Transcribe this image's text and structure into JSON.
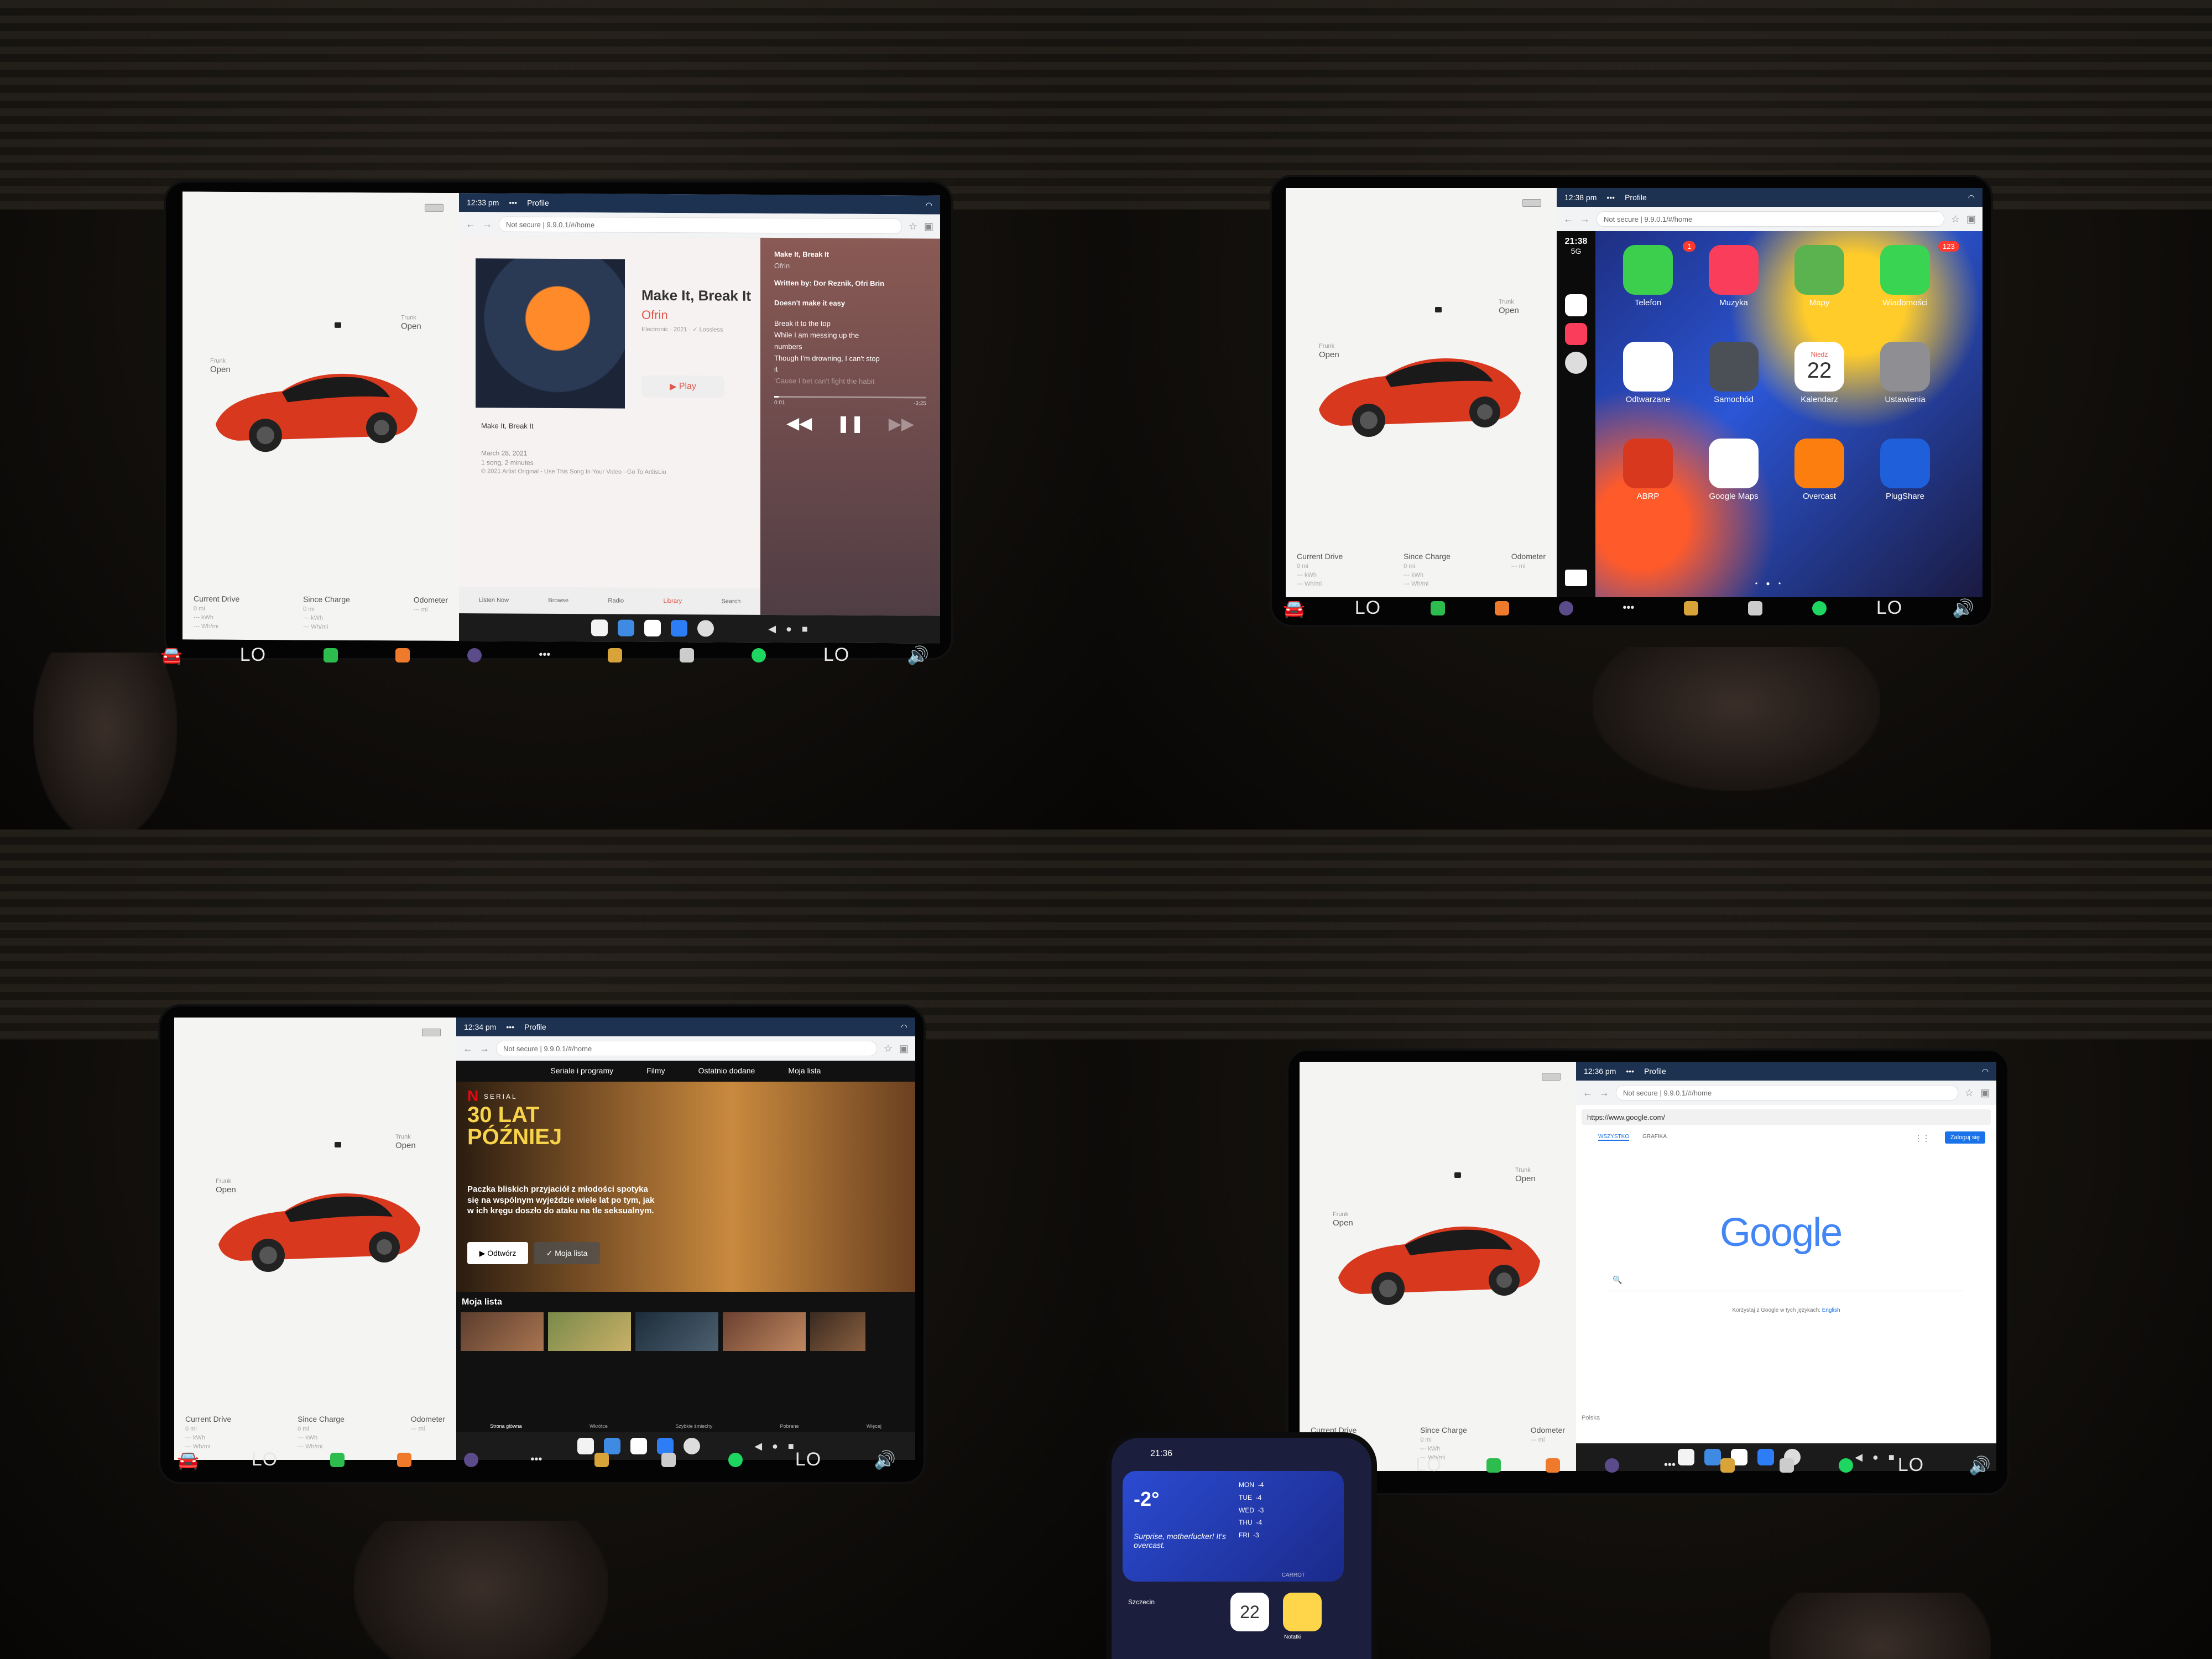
{
  "ui": {
    "lo": "LO",
    "car_panel": {
      "frunk": "Frunk",
      "frunk_state": "Open",
      "trunk": "Trunk",
      "trunk_state": "Open",
      "stats": [
        {
          "label": "Current Drive",
          "l1": "0 mi",
          "l2": "--- kWh",
          "l3": "--- Wh/mi"
        },
        {
          "label": "Since Charge",
          "l1": "0 mi",
          "l2": "--- kWh",
          "l3": "--- Wh/mi"
        },
        {
          "label": "Odometer",
          "l1": "--- mi",
          "l2": "",
          "l3": ""
        }
      ]
    },
    "profile": "Profile",
    "not_secure": "Not secure",
    "url": "9.9.0.1/#/home",
    "colors": {
      "tesla_red": "#d8381e",
      "header_blue": "#1d3150",
      "apple_red": "#e2574c",
      "netflix_red": "#e50914"
    }
  },
  "q1": {
    "time": "12:33 pm",
    "song": "Make It, Break It",
    "artist": "Ofrin",
    "meta": "Electronic · 2021 · ✓ Lossless",
    "play": "Play",
    "track": "Make It, Break It",
    "release": "March 28, 2021",
    "duration": "1 song, 2 minutes",
    "copyright": "℗ 2021 Artist Original - Use This Song In Your Video - Go To Artlist.io",
    "tabs": [
      "Listen Now",
      "Browse",
      "Radio",
      "Library",
      "Search"
    ],
    "lyrics_title": "Make It, Break It",
    "lyrics_artist": "Ofrin",
    "written_by": "Written by: Dor Reznik, Ofri Brin",
    "lyrics": [
      "Doesn't make it easy",
      "",
      "Break it to the top",
      "While I am messing up the",
      "numbers",
      "Though I'm drowning, I can't stop",
      "it",
      "'Cause I bet can't fight the habit"
    ],
    "elapsed": "0:01",
    "remaining": "-3:25"
  },
  "q2": {
    "time": "12:38 pm",
    "phone_time": "21:38",
    "network": "5G",
    "calendar_day": "Niedz",
    "calendar_num": "22",
    "apps": [
      {
        "label": "Telefon",
        "badge": "1",
        "color": "#3ccf4e",
        "icon": "phone-icon"
      },
      {
        "label": "Muzyka",
        "badge": "",
        "color": "#fa3d5a",
        "icon": "music-icon"
      },
      {
        "label": "Mapy",
        "badge": "",
        "color": "#5ab34f",
        "icon": "maps-icon"
      },
      {
        "label": "Wiadomości",
        "badge": "123",
        "color": "#39d552",
        "icon": "messages-icon"
      },
      {
        "label": "Odtwarzane",
        "badge": "",
        "color": "#ffffff",
        "icon": "now-playing-icon"
      },
      {
        "label": "Samochód",
        "badge": "",
        "color": "#4b4f56",
        "icon": "car-icon"
      },
      {
        "label": "Kalendarz",
        "badge": "",
        "color": "#ffffff",
        "icon": "calendar-icon"
      },
      {
        "label": "Ustawienia",
        "badge": "",
        "color": "#8e8e93",
        "icon": "settings-icon"
      },
      {
        "label": "ABRP",
        "badge": "",
        "color": "#d8381e",
        "icon": "abrp-icon"
      },
      {
        "label": "Google Maps",
        "badge": "",
        "color": "#ffffff",
        "icon": "google-maps-icon"
      },
      {
        "label": "Overcast",
        "badge": "",
        "color": "#fc7e0f",
        "icon": "overcast-icon"
      },
      {
        "label": "PlugShare",
        "badge": "",
        "color": "#1f5fd9",
        "icon": "plugshare-icon"
      }
    ]
  },
  "q3": {
    "time": "12:34 pm",
    "tabs": [
      "Seriale i programy",
      "Filmy",
      "Ostatnio dodane",
      "Moja lista"
    ],
    "badge": "SERIAL",
    "show_title": "30 LAT PÓŹNIEJ",
    "description": "Paczka bliskich przyjaciół z młodości spotyka się na wspólnym wyjeździe wiele lat po tym, jak w ich kręgu doszło do ataku na tle seksualnym.",
    "play": "Odtwórz",
    "mylist": "Moja lista",
    "row_title": "Moja lista",
    "bottom_nav": [
      "Strona główna",
      "Wkrótce",
      "Szybkie śmiechy",
      "Pobrane",
      "Więcej"
    ]
  },
  "q4": {
    "time": "12:36 pm",
    "addr": "https://www.google.com/",
    "tabs": [
      "WSZYSTKO",
      "GRAFIKA"
    ],
    "signin": "Zaloguj się",
    "logo": "Google",
    "offered": "Korzystaj z Google w tych językach:",
    "lang": "English",
    "country": "Polska",
    "phone": {
      "time": "21:36",
      "temp": "-2°",
      "forecast_note": "Surprise, motherfucker! It's overcast.",
      "days": [
        "MON",
        "TUE",
        "WED",
        "THU",
        "FRI"
      ],
      "temps": [
        "-4",
        "-4",
        "-3",
        "-4",
        "-3"
      ],
      "carrot": "CARROT",
      "calendar_num": "22",
      "app1": "Szczecin",
      "app2": "Notatki"
    }
  }
}
